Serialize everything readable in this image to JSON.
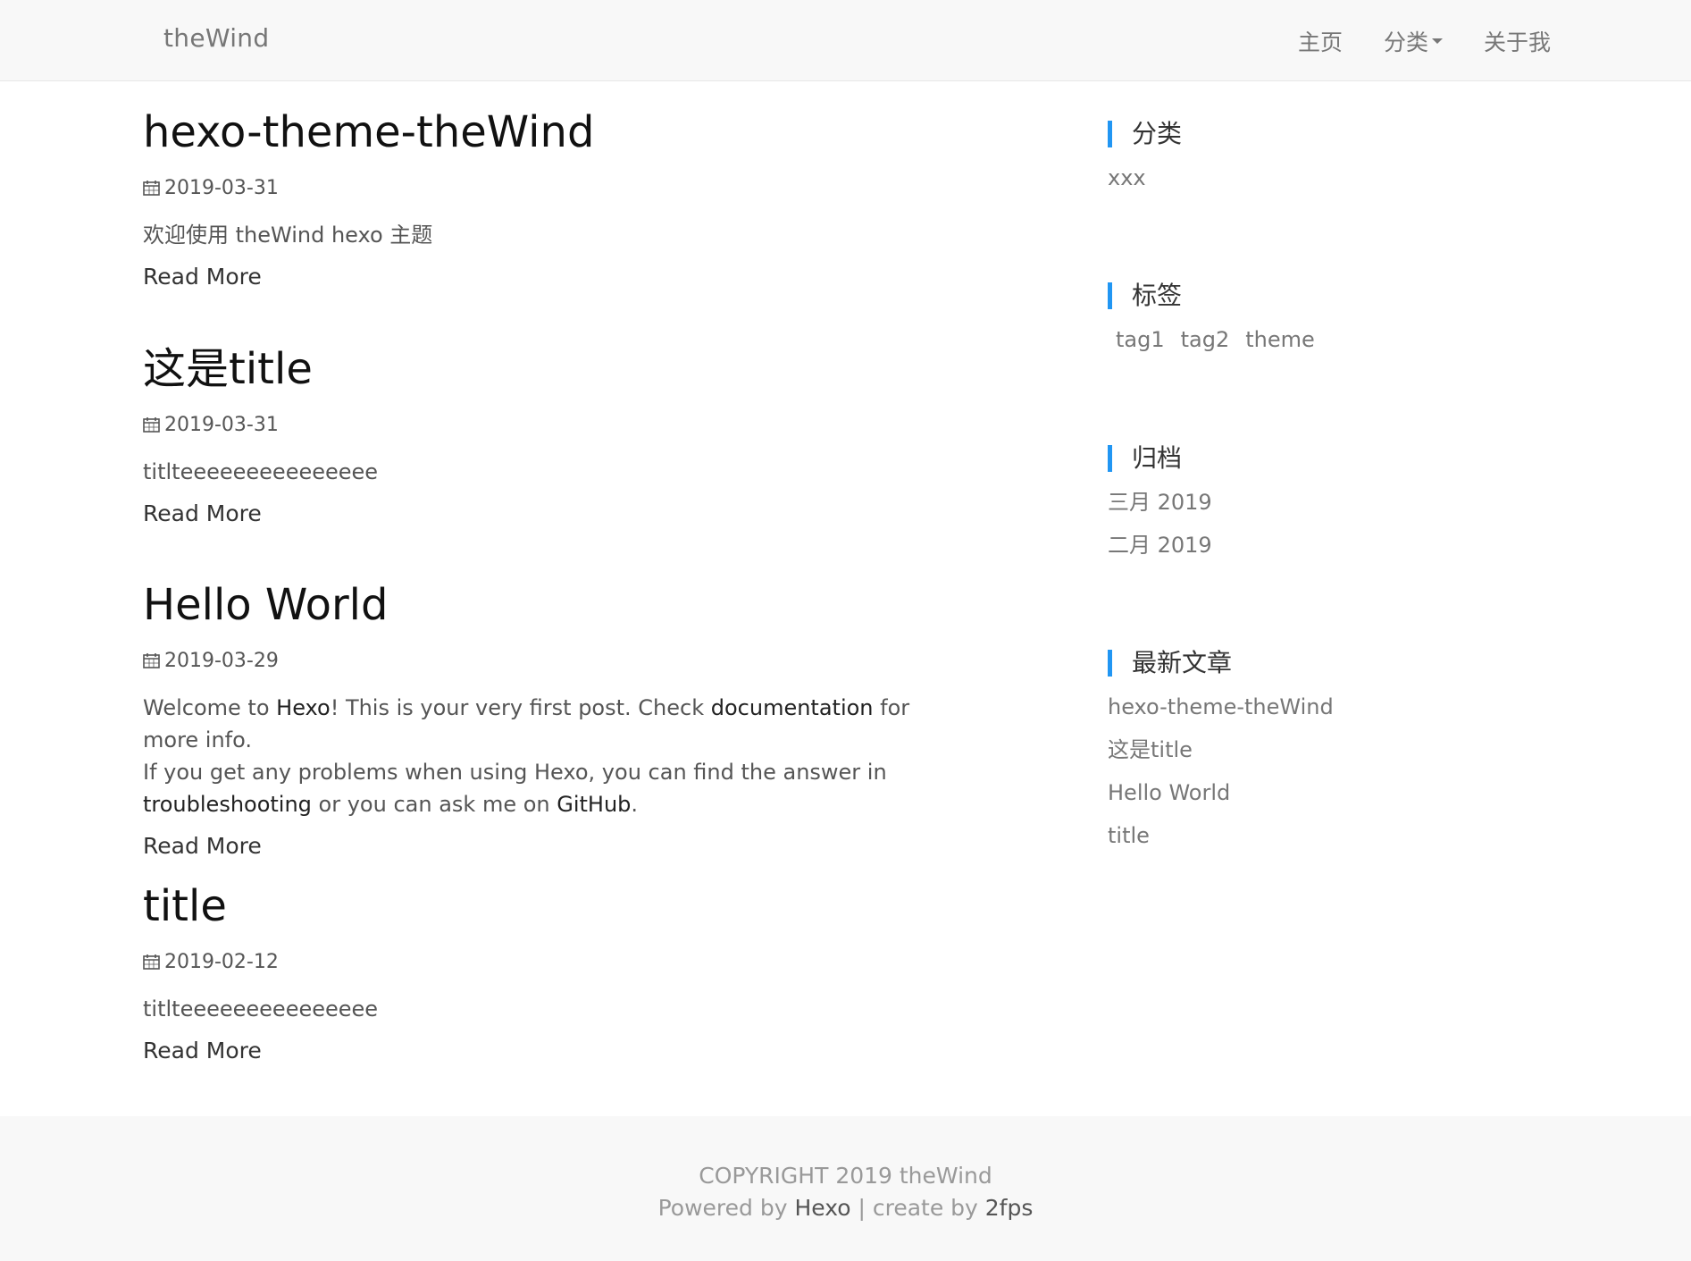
{
  "navbar": {
    "brand": "theWind",
    "links": [
      {
        "label": "主页"
      },
      {
        "label": "分类"
      },
      {
        "label": "关于我"
      }
    ]
  },
  "posts": [
    {
      "title": "hexo-theme-theWind",
      "date": "2019-03-31",
      "excerpt": "欢迎使用 theWind hexo 主题",
      "read_more": "Read More"
    },
    {
      "title": "这是title",
      "date": "2019-03-31",
      "excerpt": "titlteeeeeeeeeeeeeee",
      "read_more": "Read More"
    },
    {
      "title": "Hello World",
      "date": "2019-03-29",
      "excerpt_parts": {
        "p1": "Welcome to ",
        "hexo": "Hexo",
        "p2": "! This is your very first post. Check ",
        "documentation": "documentation",
        "p3": " for more info.",
        "p4": "If you get any problems when using Hexo, you can find the answer in",
        "troubleshooting": "troubleshooting",
        "p5": " or you can ask me on ",
        "github": "GitHub",
        "p6": "."
      },
      "read_more": "Read More"
    },
    {
      "title": "title",
      "date": "2019-02-12",
      "excerpt": "titlteeeeeeeeeeeeeee",
      "read_more": "Read More"
    }
  ],
  "sidebar": {
    "categories": {
      "title": "分类",
      "items": [
        "xxx"
      ]
    },
    "tags": {
      "title": "标签",
      "items": [
        "tag1",
        "tag2",
        "theme"
      ]
    },
    "archives": {
      "title": "归档",
      "items": [
        "三月 2019",
        "二月 2019"
      ]
    },
    "recent": {
      "title": "最新文章",
      "items": [
        "hexo-theme-theWind",
        "这是title",
        "Hello World",
        "title"
      ]
    }
  },
  "footer": {
    "copyright": "COPYRIGHT 2019 theWind",
    "powered_prefix": "Powered by ",
    "powered_link": "Hexo",
    "separator": " | create by ",
    "author_link": "2fps"
  },
  "colors": {
    "accent": "#2196f3",
    "navbar_bg": "#f8f8f8",
    "footer_bg": "#f8f8f8"
  },
  "icons": {
    "date": "calendar-icon",
    "dropdown": "caret-down-icon"
  }
}
